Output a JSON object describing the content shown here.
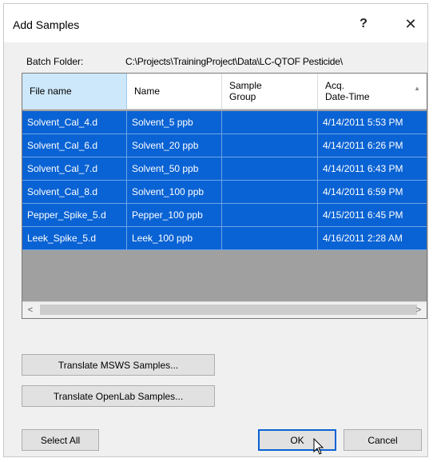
{
  "dialog": {
    "title": "Add Samples",
    "help_label": "?",
    "close_label": "✕"
  },
  "batch": {
    "label": "Batch Folder:",
    "path": "C:\\Projects\\TrainingProject\\Data\\LC-QTOF Pesticide\\"
  },
  "grid": {
    "columns": [
      {
        "label": "File name"
      },
      {
        "label": "Name"
      },
      {
        "label_line1": "Sample",
        "label_line2": "Group"
      },
      {
        "label_line1": "Acq.",
        "label_line2": "Date-Time"
      }
    ],
    "rows": [
      {
        "file": "Solvent_Cal_4.d",
        "name": "Solvent_5 ppb",
        "group": "",
        "date": "4/14/2011 5:53 PM"
      },
      {
        "file": "Solvent_Cal_6.d",
        "name": "Solvent_20 ppb",
        "group": "",
        "date": "4/14/2011 6:26 PM"
      },
      {
        "file": "Solvent_Cal_7.d",
        "name": "Solvent_50 ppb",
        "group": "",
        "date": "4/14/2011 6:43 PM"
      },
      {
        "file": "Solvent_Cal_8.d",
        "name": "Solvent_100 ppb",
        "group": "",
        "date": "4/14/2011 6:59 PM"
      },
      {
        "file": "Pepper_Spike_5.d",
        "name": "Pepper_100 ppb",
        "group": "",
        "date": "4/15/2011 6:45 PM"
      },
      {
        "file": "Leek_Spike_5.d",
        "name": "Leek_100 ppb",
        "group": "",
        "date": "4/16/2011 2:28 AM"
      }
    ],
    "scroll_left": "<",
    "scroll_right": ">"
  },
  "buttons": {
    "translate_msws": "Translate MSWS Samples...",
    "translate_openlab": "Translate OpenLab Samples...",
    "select_all": "Select All",
    "ok": "OK",
    "cancel": "Cancel"
  },
  "colors": {
    "selection": "#0a63d4",
    "empty_area": "#a0a0a0"
  }
}
